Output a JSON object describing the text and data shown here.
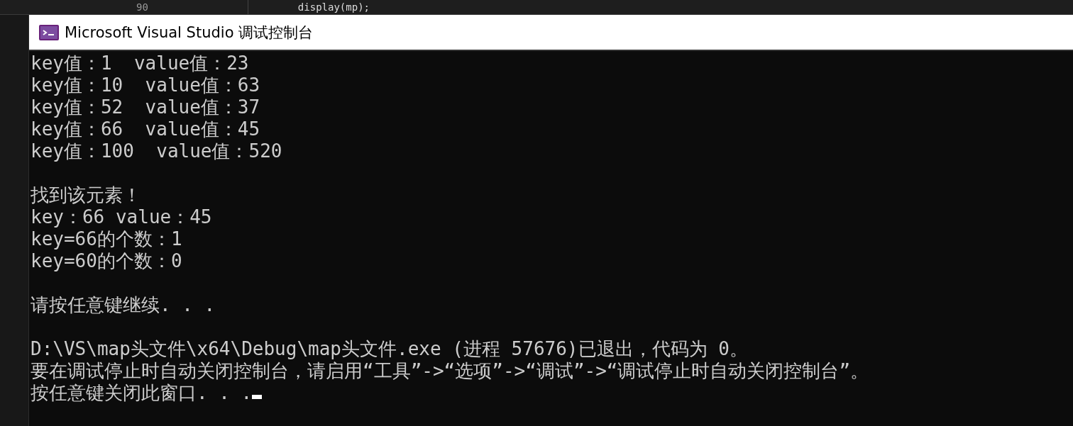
{
  "editor_line": {
    "number": "90",
    "code": "display(mp);"
  },
  "window": {
    "title": "Microsoft Visual Studio 调试控制台"
  },
  "console": {
    "blocks": [
      [
        "key值：1  value值：23",
        "key值：10  value值：63",
        "key值：52  value值：37",
        "key值：66  value值：45",
        "key值：100  value值：520"
      ],
      [
        "找到该元素！",
        "key：66 value：45",
        "key=66的个数：1",
        "key=60的个数：0"
      ],
      [
        "请按任意键继续. . ."
      ],
      [
        "D:\\VS\\map头文件\\x64\\Debug\\map头文件.exe (进程 57676)已退出，代码为 0。",
        "要在调试停止时自动关闭控制台，请启用“工具”->“选项”->“调试”->“调试停止时自动关闭控制台”。",
        "按任意键关闭此窗口. . ."
      ]
    ],
    "cursor_visible": true
  }
}
